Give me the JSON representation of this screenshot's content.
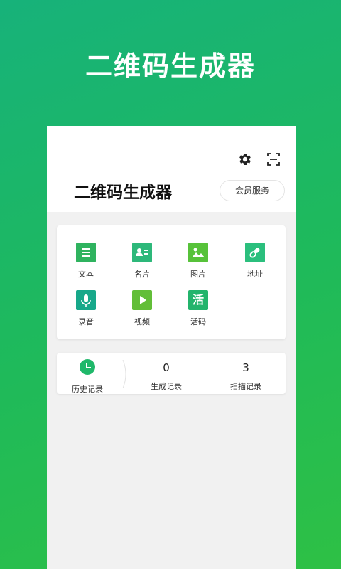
{
  "hero": {
    "title": "二维码生成器"
  },
  "header": {
    "title": "二维码生成器",
    "member_button": "会员服务",
    "icons": [
      "gear-icon",
      "scan-icon"
    ]
  },
  "tools": [
    {
      "label": "文本",
      "icon": "text-doc-icon",
      "color": "#2fb35f"
    },
    {
      "label": "名片",
      "icon": "business-card-icon",
      "color": "#2db87a"
    },
    {
      "label": "图片",
      "icon": "image-icon",
      "color": "#57c23a"
    },
    {
      "label": "地址",
      "icon": "link-icon",
      "color": "#2bbf7d"
    },
    {
      "label": "录音",
      "icon": "microphone-icon",
      "color": "#17a88a"
    },
    {
      "label": "视频",
      "icon": "play-icon",
      "color": "#62be38"
    },
    {
      "label": "活码",
      "icon": "live-code-icon",
      "color": "#23b46c",
      "glyph": "活"
    }
  ],
  "stats": {
    "history_label": "历史记录",
    "generated": {
      "value": "0",
      "label": "生成记录"
    },
    "scanned": {
      "value": "3",
      "label": "扫描记录"
    }
  },
  "colors": {
    "accent": "#1fb86a",
    "bg_gradient_start": "#17b27a",
    "bg_gradient_end": "#2ec045"
  }
}
